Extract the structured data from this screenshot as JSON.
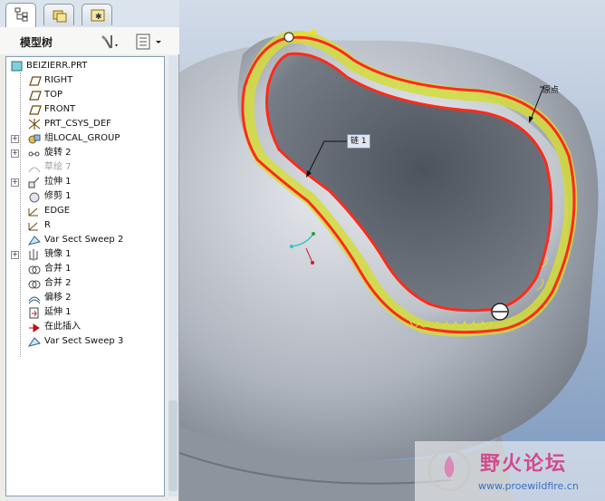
{
  "panel": {
    "title": "模型树",
    "tabs": [
      {
        "name": "model-tree-tab",
        "active": true
      },
      {
        "name": "folder-browser-tab",
        "active": false
      },
      {
        "name": "favorites-tab",
        "active": false
      }
    ]
  },
  "tree": {
    "items": [
      {
        "label": "BEIZIERR.PRT",
        "icon": "part-icon",
        "expand": false,
        "dim": false
      },
      {
        "label": "RIGHT",
        "icon": "datum-plane-icon",
        "expand": false,
        "dim": false
      },
      {
        "label": "TOP",
        "icon": "datum-plane-icon",
        "expand": false,
        "dim": false
      },
      {
        "label": "FRONT",
        "icon": "datum-plane-icon",
        "expand": false,
        "dim": false
      },
      {
        "label": "PRT_CSYS_DEF",
        "icon": "csys-icon",
        "expand": false,
        "dim": false
      },
      {
        "label": "组LOCAL_GROUP",
        "icon": "group-icon",
        "expand": true,
        "dim": false
      },
      {
        "label": "旋转 2",
        "icon": "revolve-icon",
        "expand": true,
        "dim": false
      },
      {
        "label": "草绘 7",
        "icon": "sketch-icon",
        "expand": false,
        "dim": true
      },
      {
        "label": "拉伸 1",
        "icon": "extrude-icon",
        "expand": true,
        "dim": false
      },
      {
        "label": "修剪 1",
        "icon": "trim-icon",
        "expand": false,
        "dim": false
      },
      {
        "label": "EDGE",
        "icon": "datum-curve-icon",
        "expand": false,
        "dim": false
      },
      {
        "label": "R",
        "icon": "datum-curve-icon",
        "expand": false,
        "dim": false
      },
      {
        "label": "Var Sect Sweep 2",
        "icon": "var-sect-sweep-icon",
        "expand": false,
        "dim": false
      },
      {
        "label": "镜像 1",
        "icon": "mirror-icon",
        "expand": true,
        "dim": false
      },
      {
        "label": "合并 1",
        "icon": "merge-icon",
        "expand": false,
        "dim": false
      },
      {
        "label": "合并 2",
        "icon": "merge-icon",
        "expand": false,
        "dim": false
      },
      {
        "label": "偏移 2",
        "icon": "offset-icon",
        "expand": false,
        "dim": false
      },
      {
        "label": "延伸 1",
        "icon": "extend-icon",
        "expand": false,
        "dim": false
      },
      {
        "label": "在此插入",
        "icon": "insert-here-icon",
        "expand": false,
        "dim": false
      },
      {
        "label": "Var Sect Sweep 3",
        "icon": "var-sect-sweep-icon",
        "expand": false,
        "dim": false
      }
    ]
  },
  "viewport": {
    "label_chain": "链 1",
    "label_origin": "原点"
  },
  "watermark": {
    "title": "野火论坛",
    "url": "www.proewildfire.cn"
  },
  "colors": {
    "accent_red": "#ff2a1a",
    "sweep_yellow": "#d4dc3c",
    "tree_border": "#7f9db9"
  }
}
